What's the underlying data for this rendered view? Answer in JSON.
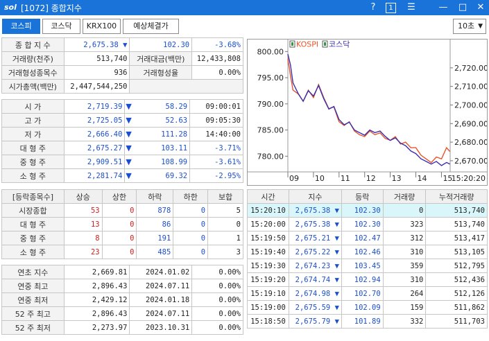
{
  "window": {
    "logo": "sol",
    "title": "[1072] 종합지수",
    "help_label": "?",
    "page_label": "1",
    "menu_label": "☰",
    "minimize_label": "—",
    "maximize_label": "□",
    "close_label": "✕"
  },
  "tabs": [
    {
      "label": "코스피",
      "active": true
    },
    {
      "label": "코스닥",
      "active": false
    },
    {
      "label": "KRX100",
      "active": false
    },
    {
      "label": "예상체결가",
      "active": false
    }
  ],
  "interval": {
    "value": "10초",
    "arrow": "▼"
  },
  "summary": {
    "composite_label": "종 합 지 수",
    "composite_value": "2,675.38",
    "composite_arrow": "▼",
    "composite_change": "102.30",
    "composite_rate": "-3.68%",
    "volume_label": "거래량(천주)",
    "volume_value": "513,740",
    "amount_label": "거래대금(백만)",
    "amount_value": "12,433,808",
    "formed_label": "거래형성종목수",
    "formed_value": "936",
    "formed_rate_label": "거래형성율",
    "formed_rate_value": "0.00%",
    "mktcap_label": "시가총액(백만)",
    "mktcap_value": "2,447,544,250"
  },
  "prices": [
    {
      "label": "시      가",
      "value": "2,719.39",
      "arrow": "▼",
      "change": "58.29",
      "extra": "09:00:01"
    },
    {
      "label": "고      가",
      "value": "2,725.05",
      "arrow": "▼",
      "change": "52.63",
      "extra": "09:05:30"
    },
    {
      "label": "저      가",
      "value": "2,666.40",
      "arrow": "▼",
      "change": "111.28",
      "extra": "14:40:00"
    },
    {
      "label": "대 형 주",
      "value": "2,675.27",
      "arrow": "▼",
      "change": "103.11",
      "extra": "-3.71%"
    },
    {
      "label": "중 형 주",
      "value": "2,909.51",
      "arrow": "▼",
      "change": "108.99",
      "extra": "-3.61%"
    },
    {
      "label": "소 형 주",
      "value": "2,281.74",
      "arrow": "▼",
      "change": "69.32",
      "extra": "-2.95%"
    }
  ],
  "breadth": {
    "headers": [
      "[등락종목수]",
      "상승",
      "상한",
      "하락",
      "하한",
      "보합"
    ],
    "rows": [
      {
        "label": "시장종합",
        "up": "53",
        "upper": "0",
        "down": "878",
        "lower": "0",
        "flat": "5"
      },
      {
        "label": "대 형 주",
        "up": "13",
        "upper": "0",
        "down": "86",
        "lower": "0",
        "flat": "0"
      },
      {
        "label": "중 형 주",
        "up": "8",
        "upper": "0",
        "down": "191",
        "lower": "0",
        "flat": "1"
      },
      {
        "label": "소 형 주",
        "up": "23",
        "upper": "0",
        "down": "485",
        "lower": "0",
        "flat": "3"
      }
    ]
  },
  "yearly": [
    {
      "label": "연초  지수",
      "value": "2,669.81",
      "date": "2024.01.02",
      "rate": "0.00%"
    },
    {
      "label": "연중  최고",
      "value": "2,896.43",
      "date": "2024.07.11",
      "rate": "0.00%"
    },
    {
      "label": "연중  최저",
      "value": "2,429.12",
      "date": "2024.01.18",
      "rate": "0.00%"
    },
    {
      "label": "52 주 최고",
      "value": "2,896.43",
      "date": "2024.07.11",
      "rate": "0.00%"
    },
    {
      "label": "52 주 최저",
      "value": "2,273.97",
      "date": "2023.10.31",
      "rate": "0.00%"
    }
  ],
  "ticks": {
    "headers": [
      "시간",
      "지수",
      "등락",
      "거래량",
      "누적거래량"
    ],
    "rows": [
      {
        "time": "15:20:10",
        "index": "2,675.38",
        "arrow": "▼",
        "change": "102.30",
        "volume": "0",
        "cum": "513,740"
      },
      {
        "time": "15:20:00",
        "index": "2,675.38",
        "arrow": "▼",
        "change": "102.30",
        "volume": "323",
        "cum": "513,740"
      },
      {
        "time": "15:19:50",
        "index": "2,675.21",
        "arrow": "▼",
        "change": "102.47",
        "volume": "312",
        "cum": "513,417"
      },
      {
        "time": "15:19:40",
        "index": "2,675.22",
        "arrow": "▼",
        "change": "102.46",
        "volume": "310",
        "cum": "513,105"
      },
      {
        "time": "15:19:30",
        "index": "2,674.23",
        "arrow": "▼",
        "change": "103.45",
        "volume": "359",
        "cum": "512,795"
      },
      {
        "time": "15:19:20",
        "index": "2,674.74",
        "arrow": "▼",
        "change": "102.94",
        "volume": "310",
        "cum": "512,436"
      },
      {
        "time": "15:19:10",
        "index": "2,674.98",
        "arrow": "▼",
        "change": "102.70",
        "volume": "264",
        "cum": "512,126"
      },
      {
        "time": "15:19:00",
        "index": "2,675.59",
        "arrow": "▼",
        "change": "102.09",
        "volume": "159",
        "cum": "511,862"
      },
      {
        "time": "15:18:50",
        "index": "2,675.79",
        "arrow": "▼",
        "change": "101.89",
        "volume": "332",
        "cum": "511,703"
      }
    ]
  },
  "colors": {
    "accent": "#1a73d9",
    "kospi_line": "#e8552a",
    "kosdaq_line": "#3a2fb0",
    "down_blue": "#1a4fd1",
    "up_red": "#d41c1c",
    "highlight_row": "#d9f7fb"
  },
  "chart_data": {
    "type": "line",
    "series": [
      {
        "name": "KOSPI",
        "axis": "right",
        "x": [
          9.0,
          9.1,
          9.2,
          9.4,
          9.6,
          9.8,
          10.0,
          10.2,
          10.4,
          10.6,
          10.8,
          11.0,
          11.2,
          11.4,
          11.6,
          11.8,
          12.0,
          12.2,
          12.4,
          12.6,
          12.8,
          13.0,
          13.2,
          13.4,
          13.6,
          13.8,
          14.0,
          14.2,
          14.4,
          14.6,
          14.8,
          15.0,
          15.2,
          15.33
        ],
        "values": [
          2725,
          2716,
          2708,
          2706,
          2702,
          2708,
          2704,
          2711,
          2704,
          2698,
          2699,
          2691,
          2689,
          2691,
          2686,
          2684,
          2683,
          2686,
          2684,
          2685,
          2682,
          2681,
          2683,
          2679,
          2680,
          2677,
          2677,
          2673,
          2671,
          2669,
          2672,
          2671,
          2677,
          2675
        ]
      },
      {
        "name": "코스닥",
        "axis": "left",
        "x": [
          9.0,
          9.1,
          9.2,
          9.4,
          9.6,
          9.8,
          10.0,
          10.2,
          10.4,
          10.6,
          10.8,
          11.0,
          11.2,
          11.4,
          11.6,
          11.8,
          12.0,
          12.2,
          12.4,
          12.6,
          12.8,
          13.0,
          13.2,
          13.4,
          13.6,
          13.8,
          14.0,
          14.2,
          14.4,
          14.6,
          14.8,
          15.0,
          15.2,
          15.33
        ],
        "values": [
          799.5,
          797.5,
          794.0,
          792.0,
          790.5,
          792.5,
          791.5,
          793.5,
          791.0,
          789.0,
          789.5,
          787.0,
          786.0,
          786.5,
          785.0,
          784.5,
          784.0,
          785.0,
          784.5,
          784.8,
          783.8,
          783.0,
          783.5,
          782.5,
          782.0,
          781.0,
          780.5,
          779.5,
          779.0,
          778.5,
          779.0,
          778.2,
          778.8,
          778.5
        ]
      }
    ],
    "x_ticks": [
      "09",
      "10",
      "11",
      "12",
      "13",
      "14",
      "15"
    ],
    "x_last_label": "15:20:20",
    "xlim": [
      9.0,
      15.34
    ],
    "y_left_ticks": [
      "800.00",
      "795.00",
      "790.00",
      "785.00",
      "780.00"
    ],
    "y_left_lim": [
      777.0,
      801.5
    ],
    "y_right_ticks": [
      "2,720.00",
      "2,710.00",
      "2,700.00",
      "2,690.00",
      "2,680.00",
      "2,670.00"
    ],
    "y_right_lim": [
      2664.0,
      2733.0
    ],
    "legend": [
      "KOSPI",
      "코스닥"
    ],
    "legend_position": "top-left",
    "grid": false
  }
}
